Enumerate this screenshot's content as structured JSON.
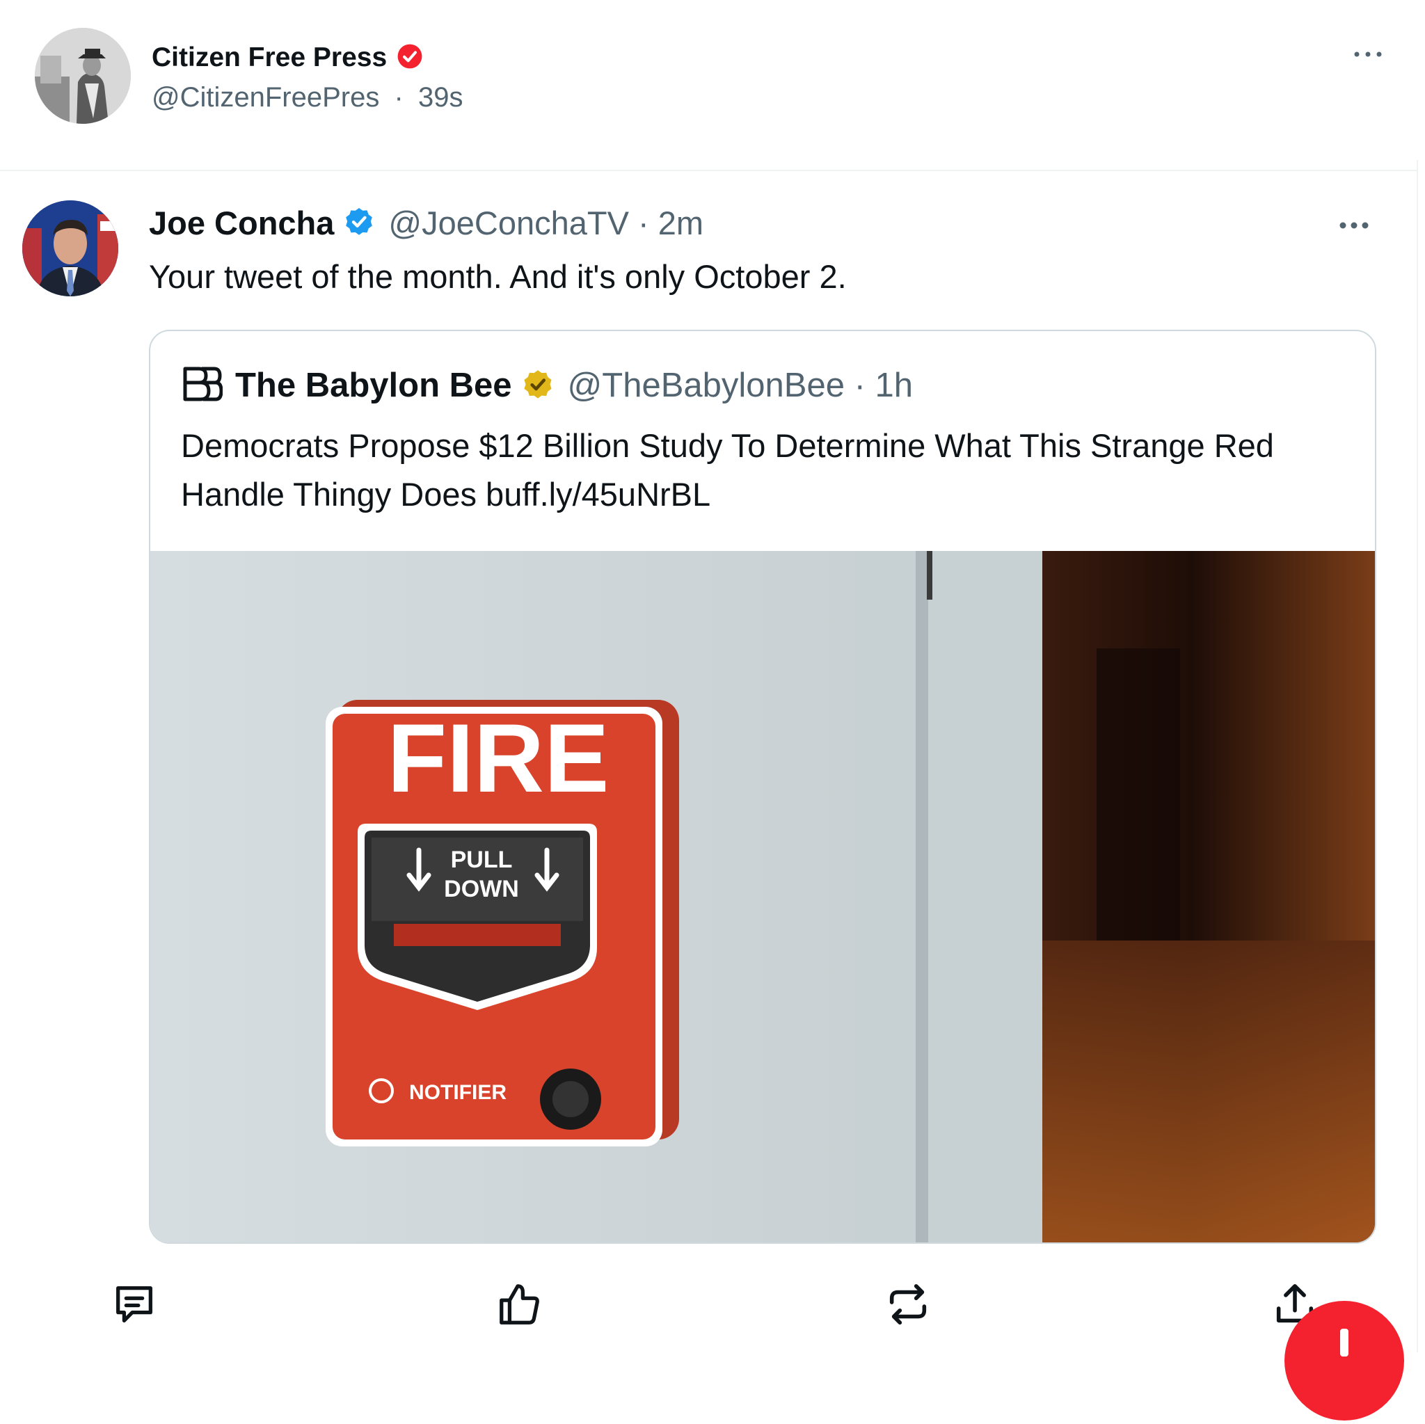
{
  "outer_post": {
    "name": "Citizen Free Press",
    "handle": "@CitizenFreePres",
    "separator": "·",
    "time": "39s"
  },
  "inner_tweet": {
    "name": "Joe Concha",
    "handle_time": "@JoeConchaTV · 2m",
    "text": "Your tweet of the month. And it's only October 2."
  },
  "quoted_tweet": {
    "name": "The Babylon Bee",
    "handle_time": "@TheBabylonBee · 1h",
    "text": "Democrats Propose $12 Billion Study To Determine What This Strange Red Handle Thingy Does buff.ly/45uNrBL"
  },
  "media": {
    "alarm_title": "FIRE",
    "pull_line1": "PULL",
    "pull_line2": "DOWN",
    "brand": "NOTIFIER"
  },
  "colors": {
    "verified_red": "#f4212e",
    "verified_blue": "#1d9bf0",
    "verified_gold": "#e2b719",
    "text_primary": "#0f1419",
    "text_secondary": "#536471",
    "alarm_red": "#d9432b"
  },
  "icons": {
    "more": "more-dots-icon",
    "comment": "comment-icon",
    "like": "thumbs-up-icon",
    "repost": "repost-icon",
    "share": "share-icon"
  }
}
